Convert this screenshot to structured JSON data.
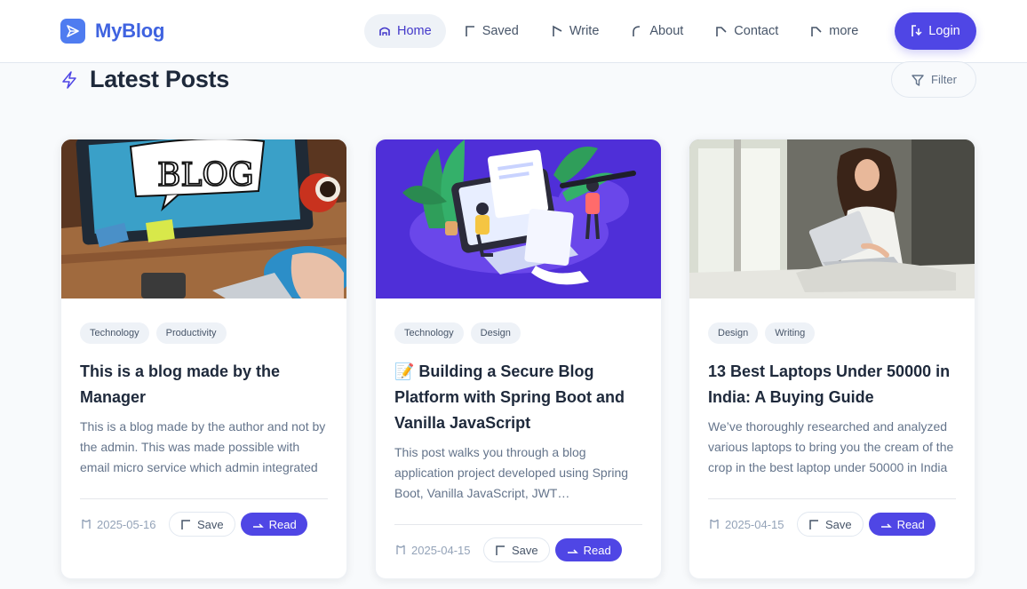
{
  "brand": {
    "name": "MyBlog",
    "icon": "paper-plane-icon",
    "color": "#4f7cf0"
  },
  "nav": {
    "items": [
      {
        "label": "Home",
        "icon": "home-icon",
        "active": true
      },
      {
        "label": "Saved",
        "icon": "bookmark-icon",
        "active": false
      },
      {
        "label": "Write",
        "icon": "pen-icon",
        "active": false
      },
      {
        "label": "About",
        "icon": "info-icon",
        "active": false
      },
      {
        "label": "Contact",
        "icon": "mail-icon",
        "active": false
      },
      {
        "label": "more",
        "icon": "menu-icon",
        "active": false
      }
    ],
    "login_label": "Login",
    "accent": "#4f46e5"
  },
  "header": {
    "title": "Latest Posts",
    "icon": "lightning-icon",
    "filter_label": "Filter"
  },
  "posts": [
    {
      "image": "blog-desk-photo",
      "tags": [
        "Technology",
        "Productivity"
      ],
      "title": "This is a blog made by the Manager",
      "excerpt": "This is a blog made by the author and not by the admin. This was made possible with email micro service which admin integrated",
      "date": "2025-05-16",
      "save_label": "Save",
      "read_label": "Read"
    },
    {
      "image": "blog-illustration-purple",
      "tags": [
        "Technology",
        "Design"
      ],
      "title": "📝 Building a Secure Blog Platform with Spring Boot and Vanilla JavaScript",
      "excerpt": "This post walks you through a blog application project developed using Spring Boot, Vanilla JavaScript, JWT…",
      "date": "2025-04-15",
      "save_label": "Save",
      "read_label": "Read"
    },
    {
      "image": "woman-laptop-photo",
      "tags": [
        "Design",
        "Writing"
      ],
      "title": "13 Best Laptops Under 50000 in India: A Buying Guide",
      "excerpt": "We’ve thoroughly researched and analyzed various laptops to bring you the cream of the crop in the best laptop under 50000 in India",
      "date": "2025-04-15",
      "save_label": "Save",
      "read_label": "Read"
    }
  ]
}
